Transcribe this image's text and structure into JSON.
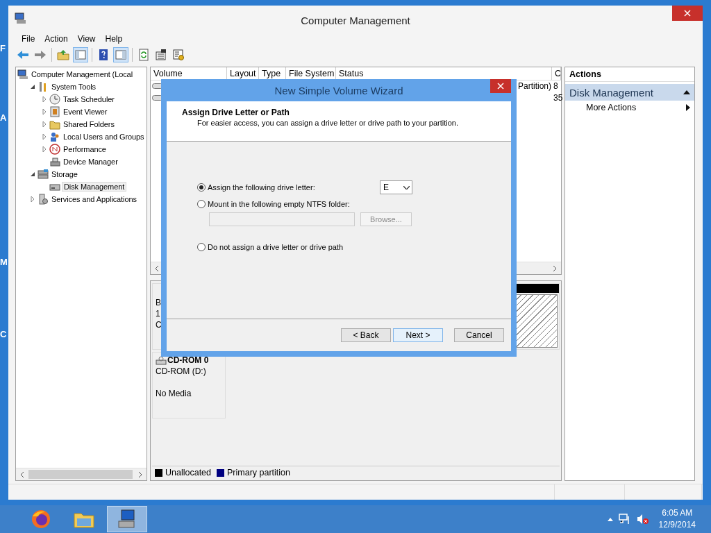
{
  "desktop": {
    "icon_labels": [
      "F",
      "A",
      "M",
      "C"
    ]
  },
  "window": {
    "title": "Computer Management"
  },
  "menu": [
    "File",
    "Action",
    "View",
    "Help"
  ],
  "toolbar": [
    {
      "kind": "back",
      "on": false
    },
    {
      "kind": "forward",
      "on": false
    },
    {
      "kind": "up-folder",
      "on": false
    },
    {
      "kind": "console-tree",
      "on": true
    },
    {
      "kind": "help",
      "on": false
    },
    {
      "kind": "action-pane",
      "on": true
    },
    {
      "kind": "refresh",
      "on": false
    },
    {
      "kind": "properties",
      "on": false
    },
    {
      "kind": "settings",
      "on": false
    }
  ],
  "tree": {
    "label": "Computer Management (Local",
    "kind": "computer",
    "selected": false,
    "children": [
      {
        "label": "System Tools",
        "kind": "tools",
        "expanded": true,
        "selected": false,
        "children": [
          {
            "label": "Task Scheduler",
            "kind": "clock",
            "expanded": false,
            "selected": false
          },
          {
            "label": "Event Viewer",
            "kind": "log",
            "expanded": false,
            "selected": false
          },
          {
            "label": "Shared Folders",
            "kind": "folder",
            "expanded": false,
            "selected": false
          },
          {
            "label": "Local Users and Groups",
            "kind": "users",
            "expanded": false,
            "selected": false
          },
          {
            "label": "Performance",
            "kind": "gauge",
            "expanded": false,
            "selected": false
          },
          {
            "label": "Device Manager",
            "kind": "device",
            "selected": false
          }
        ]
      },
      {
        "label": "Storage",
        "kind": "storage",
        "expanded": true,
        "selected": false,
        "children": [
          {
            "label": "Disk Management",
            "kind": "drive",
            "selected": true
          }
        ]
      },
      {
        "label": "Services and Applications",
        "kind": "services",
        "expanded": false,
        "selected": false
      }
    ]
  },
  "volume_list": {
    "columns": [
      "Volume",
      "Layout",
      "Type",
      "File System",
      "Status",
      "C"
    ],
    "rows": [
      {
        "status": "Partition)",
        "column_6": "8"
      },
      {
        "column_6": "35"
      }
    ]
  },
  "disks": [
    {
      "kind": "disk",
      "label_lines": [
        "B",
        "1",
        "C"
      ]
    },
    {
      "kind": "cdrom",
      "name": "CD-ROM 0",
      "label_lines": [
        "CD-ROM (D:)",
        "No Media"
      ]
    }
  ],
  "legend": [
    {
      "label": "Unallocated",
      "color": "#000000"
    },
    {
      "label": "Primary partition",
      "color": "#000080"
    }
  ],
  "actions": {
    "title": "Actions",
    "section": "Disk Management",
    "expanded": true,
    "items": [
      "More Actions"
    ]
  },
  "wizard": {
    "title": "New Simple Volume Wizard",
    "heading": "Assign Drive Letter or Path",
    "subheading": "For easier access, you can assign a drive letter or drive path to your partition.",
    "options": [
      {
        "kind": "letter",
        "label": "Assign the following drive letter:",
        "selected": true
      },
      {
        "kind": "folder",
        "label": "Mount in the following empty NTFS folder:",
        "selected": false
      },
      {
        "kind": "none",
        "label": "Do not assign a drive letter or drive path",
        "selected": false
      }
    ],
    "drive_letter": "E",
    "browse": {
      "label": "Browse...",
      "disabled": true
    },
    "buttons": [
      {
        "label": "< Back",
        "focused": false
      },
      {
        "label": "Next >",
        "focused": true
      },
      {
        "label": "Cancel",
        "focused": false
      }
    ]
  },
  "taskbar": {
    "apps": [
      {
        "kind": "firefox",
        "active": false
      },
      {
        "kind": "explorer",
        "active": false
      },
      {
        "kind": "computer-management",
        "active": true
      }
    ],
    "time": "6:05 AM",
    "date": "12/9/2014"
  }
}
